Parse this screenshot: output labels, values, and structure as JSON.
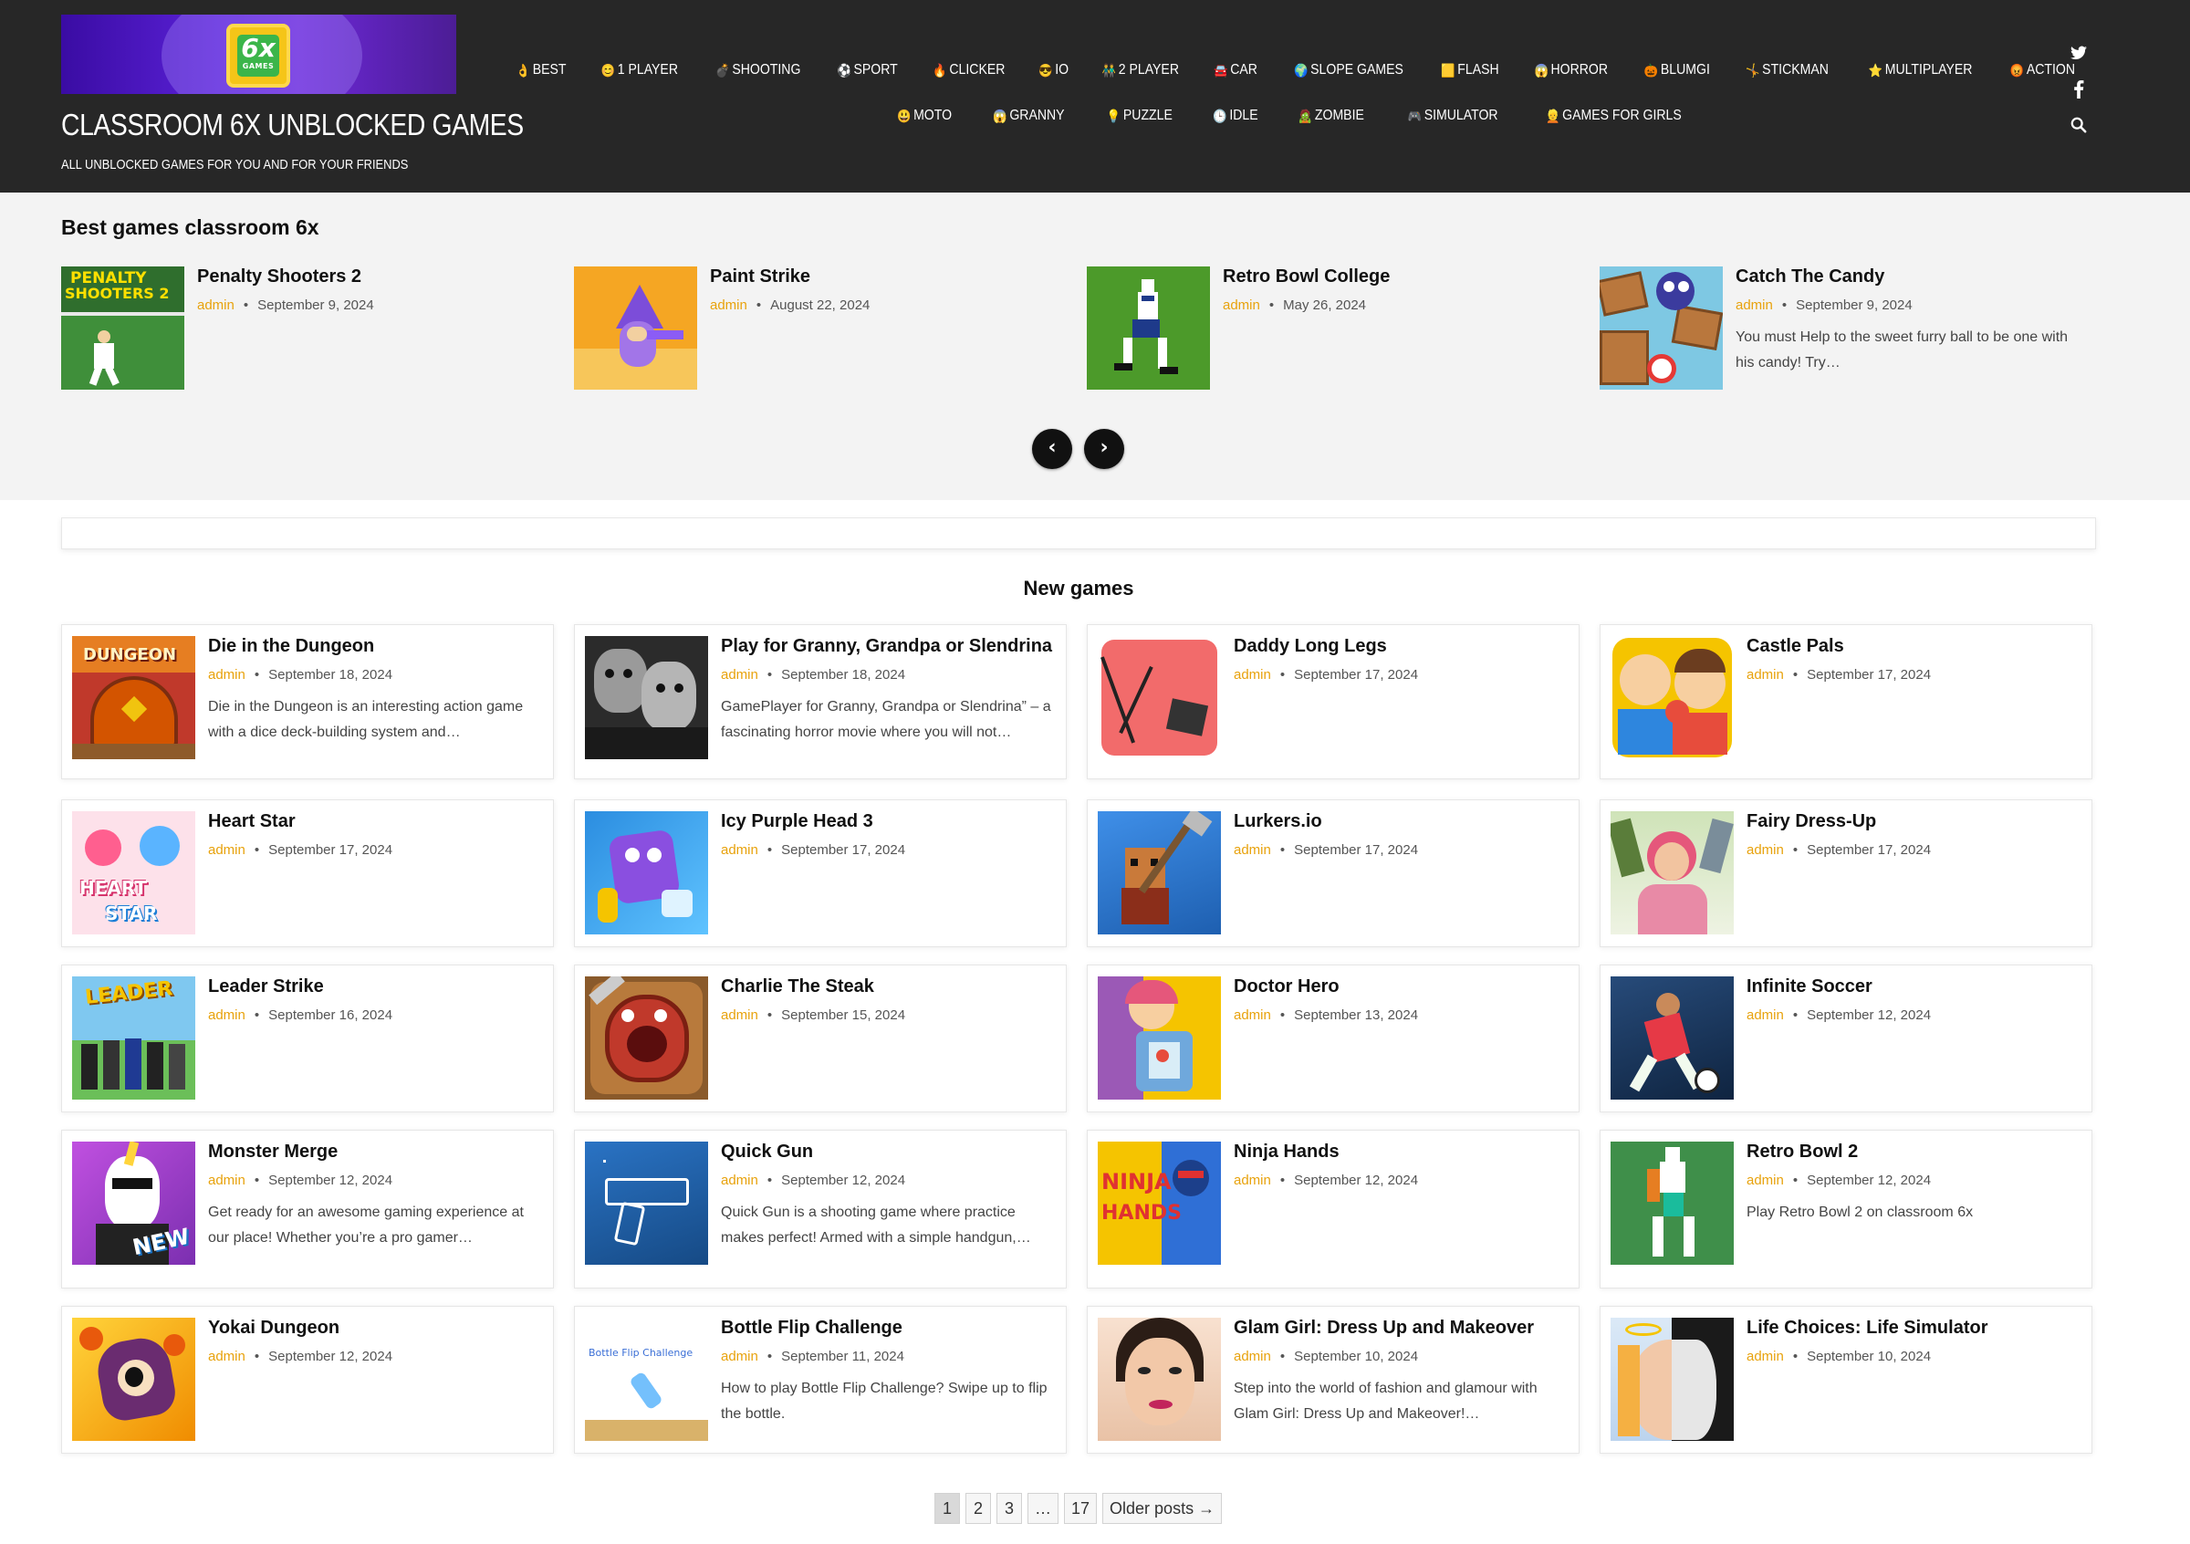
{
  "site": {
    "logo_six": "6x",
    "logo_games": "GAMES",
    "title": "CLASSROOM 6X UNBLOCKED GAMES",
    "tagline": "ALL UNBLOCKED GAMES FOR YOU AND FOR YOUR FRIENDS"
  },
  "nav": {
    "row1": [
      {
        "emoji": "👌",
        "label": "BEST"
      },
      {
        "emoji": "😊",
        "label": "1 PLAYER"
      },
      {
        "emoji": "💣",
        "label": "SHOOTING"
      },
      {
        "emoji": "⚽",
        "label": "SPORT"
      },
      {
        "emoji": "🔥",
        "label": "CLICKER"
      },
      {
        "emoji": "😎",
        "label": "IO"
      },
      {
        "emoji": "👬",
        "label": "2 PLAYER"
      },
      {
        "emoji": "🚘",
        "label": "CAR"
      },
      {
        "emoji": "🌍",
        "label": "SLOPE GAMES"
      },
      {
        "emoji": "🟨",
        "label": "FLASH"
      },
      {
        "emoji": "😱",
        "label": "HORROR"
      },
      {
        "emoji": "🎃",
        "label": "BLUMGI"
      },
      {
        "emoji": "🤸",
        "label": "STICKMAN"
      },
      {
        "emoji": "⭐",
        "label": "MULTIPLAYER"
      },
      {
        "emoji": "😡",
        "label": "ACTION"
      }
    ],
    "row2": [
      {
        "emoji": "😃",
        "label": "MOTO"
      },
      {
        "emoji": "😱",
        "label": "GRANNY"
      },
      {
        "emoji": "💡",
        "label": "PUZZLE"
      },
      {
        "emoji": "🕒",
        "label": "IDLE"
      },
      {
        "emoji": "🧟",
        "label": "ZOMBIE"
      },
      {
        "emoji": "🎮",
        "label": "SIMULATOR"
      },
      {
        "emoji": "👱",
        "label": "GAMES FOR GIRLS"
      }
    ]
  },
  "social": {
    "twitter": "twitter-icon",
    "facebook": "facebook-icon",
    "search": "search-icon"
  },
  "best": {
    "title": "Best games classroom 6x",
    "items": [
      {
        "title": "Penalty Shooters 2",
        "author": "admin",
        "date": "September 9, 2024",
        "excerpt": ""
      },
      {
        "title": "Paint Strike",
        "author": "admin",
        "date": "August 22, 2024",
        "excerpt": ""
      },
      {
        "title": "Retro Bowl College",
        "author": "admin",
        "date": "May 26, 2024",
        "excerpt": ""
      },
      {
        "title": "Catch The Candy",
        "author": "admin",
        "date": "September 9, 2024",
        "excerpt": "You must Help to the sweet furry ball to be one with his candy! Try…"
      }
    ],
    "thumb_text": {
      "penalty_line1": "PENALTY",
      "penalty_line2": "SHOOTERS 2"
    }
  },
  "new_games": {
    "title": "New games",
    "items": [
      {
        "title": "Die in the Dungeon",
        "author": "admin",
        "date": "September 18, 2024",
        "excerpt": "Die in the Dungeon is an interesting action game with a dice deck-building system and…"
      },
      {
        "title": "Play for Granny, Grandpa or Slendrina",
        "author": "admin",
        "date": "September 18, 2024",
        "excerpt": "GamePlayer for Granny, Grandpa or Slendrina” – a fascinating horror movie where you will not…"
      },
      {
        "title": "Daddy Long Legs",
        "author": "admin",
        "date": "September 17, 2024",
        "excerpt": ""
      },
      {
        "title": "Castle Pals",
        "author": "admin",
        "date": "September 17, 2024",
        "excerpt": ""
      },
      {
        "title": "Heart Star",
        "author": "admin",
        "date": "September 17, 2024",
        "excerpt": ""
      },
      {
        "title": "Icy Purple Head 3",
        "author": "admin",
        "date": "September 17, 2024",
        "excerpt": ""
      },
      {
        "title": "Lurkers.io",
        "author": "admin",
        "date": "September 17, 2024",
        "excerpt": ""
      },
      {
        "title": "Fairy Dress-Up",
        "author": "admin",
        "date": "September 17, 2024",
        "excerpt": ""
      },
      {
        "title": "Leader Strike",
        "author": "admin",
        "date": "September 16, 2024",
        "excerpt": ""
      },
      {
        "title": "Charlie The Steak",
        "author": "admin",
        "date": "September 15, 2024",
        "excerpt": ""
      },
      {
        "title": "Doctor Hero",
        "author": "admin",
        "date": "September 13, 2024",
        "excerpt": ""
      },
      {
        "title": "Infinite Soccer",
        "author": "admin",
        "date": "September 12, 2024",
        "excerpt": ""
      },
      {
        "title": "Monster Merge",
        "author": "admin",
        "date": "September 12, 2024",
        "excerpt": "Get ready for an awesome gaming experience at our place! Whether you’re a pro gamer…"
      },
      {
        "title": "Quick Gun",
        "author": "admin",
        "date": "September 12, 2024",
        "excerpt": "Quick Gun is a shooting game where practice makes perfect! Armed with a simple handgun,…"
      },
      {
        "title": "Ninja Hands",
        "author": "admin",
        "date": "September 12, 2024",
        "excerpt": ""
      },
      {
        "title": "Retro Bowl 2",
        "author": "admin",
        "date": "September 12, 2024",
        "excerpt": "Play Retro Bowl 2 on classroom 6x"
      },
      {
        "title": "Yokai Dungeon",
        "author": "admin",
        "date": "September 12, 2024",
        "excerpt": ""
      },
      {
        "title": "Bottle Flip Challenge",
        "author": "admin",
        "date": "September 11, 2024",
        "excerpt": "How to play Bottle Flip Challenge? Swipe up to flip the bottle."
      },
      {
        "title": "Glam Girl: Dress Up and Makeover",
        "author": "admin",
        "date": "September 10, 2024",
        "excerpt": "Step into the world of fashion and glamour with Glam Girl: Dress Up and Makeover!…"
      },
      {
        "title": "Life Choices: Life Simulator",
        "author": "admin",
        "date": "September 10, 2024",
        "excerpt": ""
      }
    ],
    "thumb_text": {
      "dungeon": "DUNGEON",
      "heart": "HEART",
      "star": "STAR",
      "leader": "LEADER",
      "new": "NEW",
      "ninja": "NINJA",
      "hands": "HANDS",
      "bottle": "Bottle Flip Challenge"
    }
  },
  "pagination": {
    "pages": [
      "1",
      "2",
      "3",
      "…",
      "17"
    ],
    "current": "1",
    "older": "Older posts →"
  },
  "colors": {
    "header_bg": "#272727",
    "best_bg": "#f3f3f3",
    "author_accent": "#e8a20c",
    "logo_purple": "#5b21d8"
  }
}
